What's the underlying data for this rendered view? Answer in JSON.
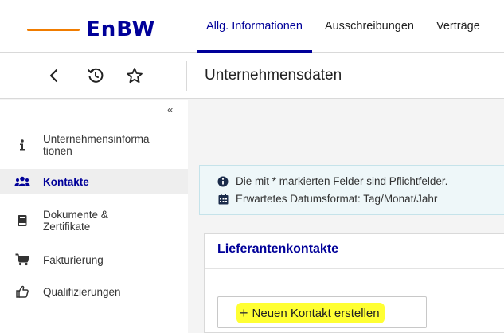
{
  "header": {
    "logo_text": "EnBW",
    "tabs": [
      {
        "label": "Allg. Informationen",
        "active": true
      },
      {
        "label": "Ausschreibungen",
        "active": false
      },
      {
        "label": "Verträge",
        "active": false
      }
    ]
  },
  "toolbar": {
    "back_icon": "chevron-left-icon",
    "history_icon": "history-icon",
    "favorite_icon": "star-icon",
    "page_title": "Unternehmensdaten"
  },
  "sidebar": {
    "collapse_label": "«",
    "items": [
      {
        "label": "Unternehmensinforma\ntionen",
        "icon": "info-icon",
        "active": false
      },
      {
        "label": "Kontakte",
        "icon": "users-icon",
        "active": true
      },
      {
        "label": "Dokumente &\nZertifikate",
        "icon": "book-icon",
        "active": false
      },
      {
        "label": "Fakturierung",
        "icon": "cart-icon",
        "active": false
      },
      {
        "label": "Qualifizierungen",
        "icon": "thumbs-up-icon",
        "active": false
      }
    ]
  },
  "info": {
    "required_note": "Die mit * markierten Felder sind Pflichtfelder.",
    "date_note": "Erwartetes Datumsformat: Tag/Monat/Jahr"
  },
  "panel": {
    "title": "Lieferantenkontakte",
    "new_contact_label": "Neuen Kontakt erstellen"
  },
  "colors": {
    "brand_blue": "#000099",
    "brand_orange": "#f07c00",
    "highlight": "#ffff33"
  }
}
